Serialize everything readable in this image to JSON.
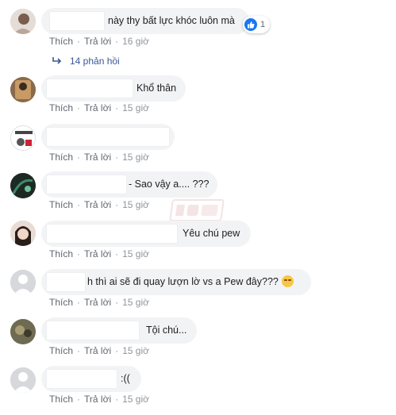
{
  "actions": {
    "like": "Thích",
    "reply": "Trả lời",
    "sep": "·"
  },
  "comments": [
    {
      "text": "này thy bất lực khóc luôn mà",
      "time": "16 giờ",
      "reactions": {
        "count": "1"
      },
      "replies": "14 phản hồi"
    },
    {
      "text": "Khổ thân",
      "time": "15 giờ"
    },
    {
      "text": "",
      "time": "15 giờ"
    },
    {
      "text": "- Sao vậy a.... ???",
      "time": "15 giờ"
    },
    {
      "text": "Yêu chú pew",
      "time": "15 giờ"
    },
    {
      "text": "h thì ai sẽ đi quay lượn lờ vs a Pew đây???",
      "time": "15 giờ",
      "emoji": "unamused-face-emoji"
    },
    {
      "text": "Tội chú...",
      "time": "15 giờ"
    },
    {
      "text": ":((",
      "time": "15 giờ"
    }
  ],
  "colors": {
    "bubble": "#f2f3f5",
    "link": "#385898",
    "like_blue": "#1877f2",
    "meta": "#90949c"
  }
}
